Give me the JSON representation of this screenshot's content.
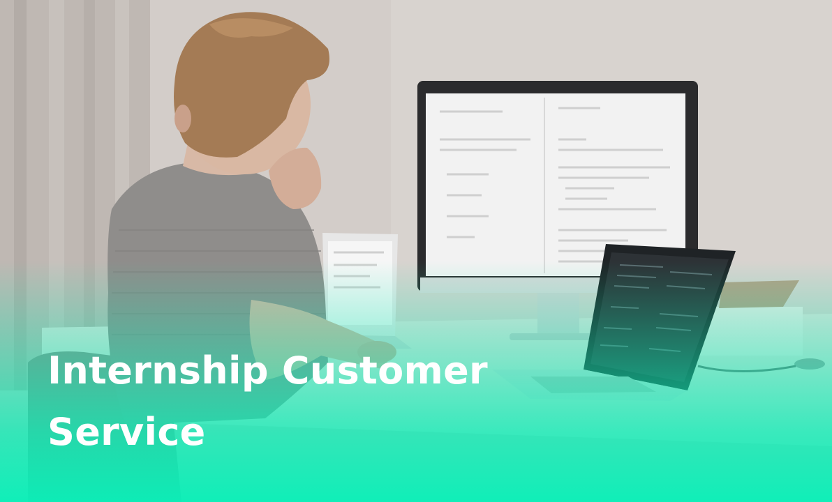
{
  "headline": {
    "line1": "Internship Customer",
    "line2": "Service"
  },
  "colors": {
    "overlay_accent": "#08F0B4",
    "headline_text": "#FFFFFF"
  }
}
